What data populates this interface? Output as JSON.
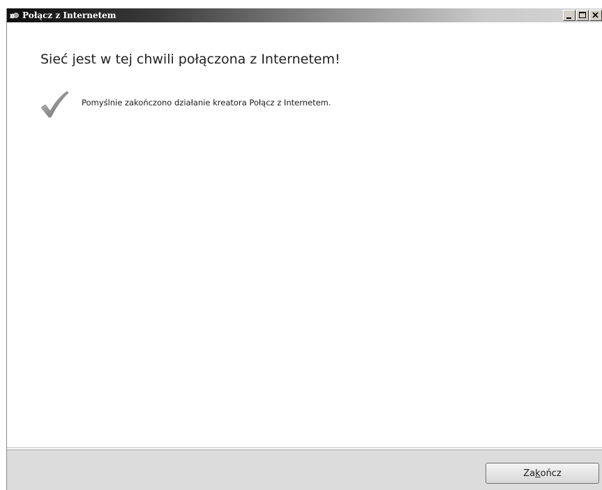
{
  "window": {
    "title": "Połącz z Internetem",
    "icon": "network-wizard-icon",
    "buttons": [
      "minimize-icon",
      "maximize-icon",
      "close-icon"
    ]
  },
  "main": {
    "heading": "Sieć jest w tej chwili połączona z Internetem!",
    "status_icon": "checkmark-icon",
    "message": "Pomyślnie zakończono działanie kreatora Połącz z Internetem."
  },
  "footer": {
    "finish_label_pre": "Za",
    "finish_label_accel": "k",
    "finish_label_post": "ończ"
  },
  "colors": {
    "titlebar_start": "#0d0d0d",
    "titlebar_end": "#d6d6d6",
    "footer_bg": "#dcdcdc",
    "check_gray": "#8a8a8a"
  }
}
